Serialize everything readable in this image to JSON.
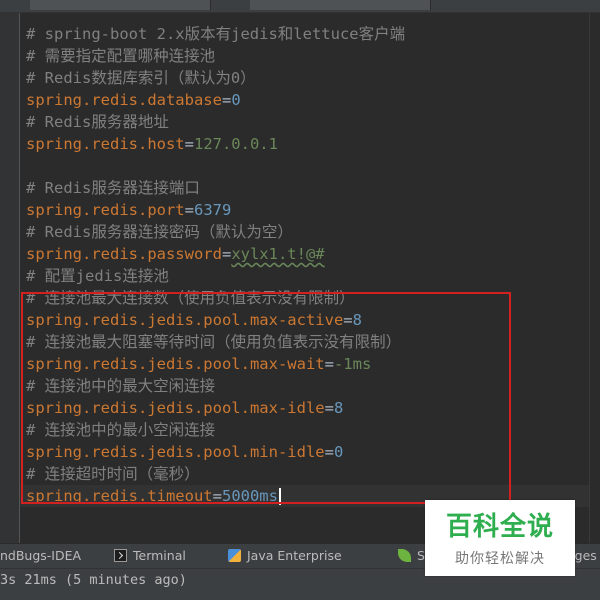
{
  "editor": {
    "lines": [
      {
        "kind": "comment",
        "text": "# spring-boot 2.x版本有jedis和lettuce客户端"
      },
      {
        "kind": "comment",
        "text": "# 需要指定配置哪种连接池"
      },
      {
        "kind": "comment",
        "text": "# Redis数据库索引（默认为0）"
      },
      {
        "kind": "prop",
        "key": "spring.redis.database",
        "value": "0"
      },
      {
        "kind": "comment",
        "text": "# Redis服务器地址"
      },
      {
        "kind": "prop",
        "key": "spring.redis.host",
        "value": "127.0.0.1"
      },
      {
        "kind": "blank",
        "text": ""
      },
      {
        "kind": "comment",
        "text": "# Redis服务器连接端口"
      },
      {
        "kind": "prop",
        "key": "spring.redis.port",
        "value": "6379"
      },
      {
        "kind": "comment",
        "text": "# Redis服务器连接密码（默认为空）"
      },
      {
        "kind": "prop",
        "key": "spring.redis.password",
        "value": "xylx1.t!@#"
      },
      {
        "kind": "comment",
        "text": "# 配置jedis连接池"
      },
      {
        "kind": "comment",
        "text": "# 连接池最大连接数（使用负值表示没有限制）"
      },
      {
        "kind": "prop",
        "key": "spring.redis.jedis.pool.max-active",
        "value": "8"
      },
      {
        "kind": "comment",
        "text": "# 连接池最大阻塞等待时间（使用负值表示没有限制）"
      },
      {
        "kind": "prop",
        "key": "spring.redis.jedis.pool.max-wait",
        "value": "-1ms"
      },
      {
        "kind": "comment",
        "text": "# 连接池中的最大空闲连接"
      },
      {
        "kind": "prop",
        "key": "spring.redis.jedis.pool.max-idle",
        "value": "8"
      },
      {
        "kind": "comment",
        "text": "# 连接池中的最小空闲连接"
      },
      {
        "kind": "prop",
        "key": "spring.redis.jedis.pool.min-idle",
        "value": "0"
      },
      {
        "kind": "comment",
        "text": "# 连接超时时间（毫秒）"
      },
      {
        "kind": "prop",
        "key": "spring.redis.timeout",
        "value": "5000ms"
      }
    ],
    "operator": "=",
    "highlight_color": "#d32020"
  },
  "toolbar": {
    "findbugs_label": "ndBugs-IDEA",
    "terminal_label": "Terminal",
    "java_enterprise_label": "Java Enterprise",
    "spring_label": "S",
    "images_label": "ages"
  },
  "status": {
    "message": "3s 21ms (5 minutes ago)"
  },
  "watermark": {
    "title": "百科全说",
    "subtitle": "助你轻松解决"
  },
  "icons": {
    "terminal": "terminal-icon",
    "java_enterprise": "java-enterprise-icon",
    "spring": "spring-icon"
  }
}
